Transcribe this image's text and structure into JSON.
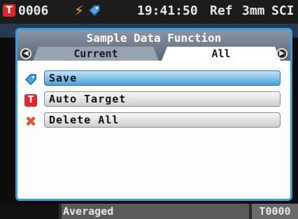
{
  "status_bar": {
    "sample_number": "0006",
    "time": "19:41:50",
    "reference": "Ref",
    "aperture": "3mm",
    "mode": "SCI",
    "target_icon": "T",
    "icons": [
      "target-t-icon",
      "lightning-icon",
      "tag-icon"
    ]
  },
  "dialog": {
    "title": "Sample Data Function",
    "tabs": [
      {
        "label": "Current",
        "active": false
      },
      {
        "label": "All",
        "active": true
      }
    ],
    "menu": [
      {
        "label": "Save",
        "icon": "tag-icon",
        "selected": true
      },
      {
        "label": "Auto Target",
        "icon": "T",
        "selected": false
      },
      {
        "label": "Delete All",
        "icon": "x-icon",
        "selected": false
      }
    ]
  },
  "bottom_bar": {
    "status": "Averaged",
    "target": "T0000"
  },
  "colors": {
    "accent": "#3c9dd6",
    "selected_item": "#4e9fd8",
    "target_red": "#e0262b",
    "bolt_orange": "#ff9b1a"
  }
}
